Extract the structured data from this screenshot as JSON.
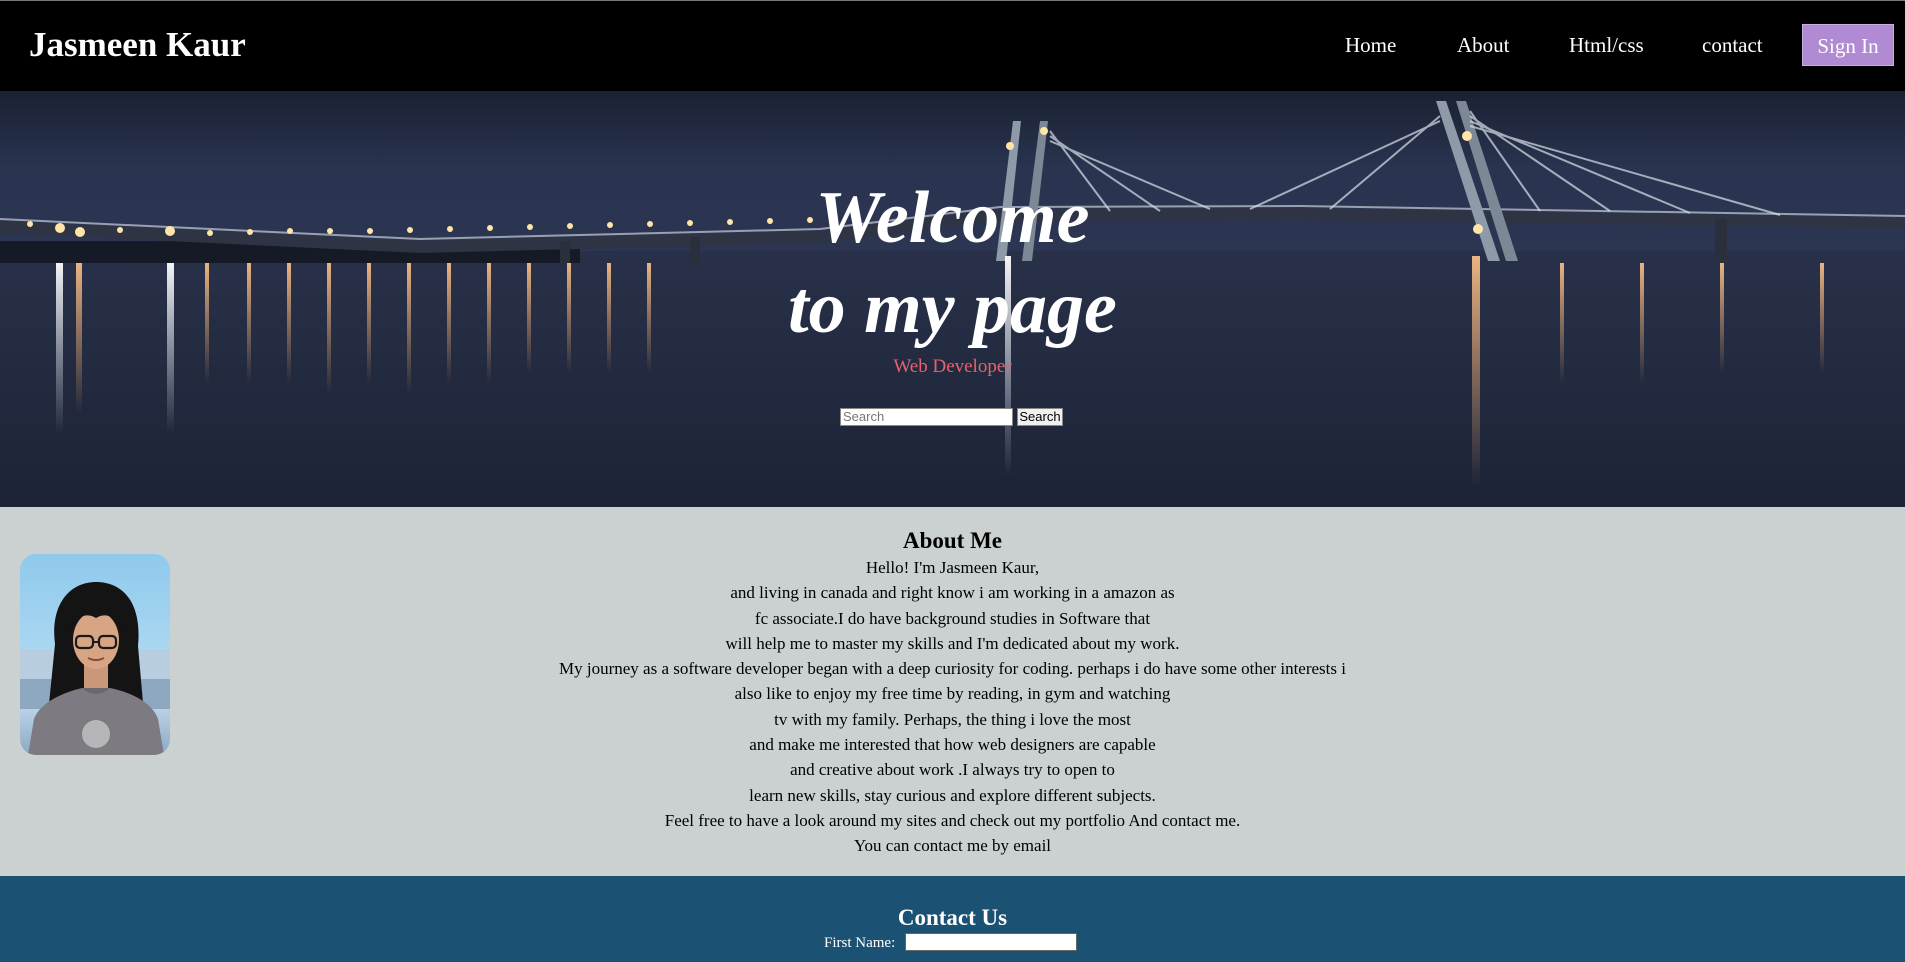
{
  "header": {
    "brand": "Jasmeen Kaur",
    "nav": [
      "Home",
      "About",
      "Html/css",
      "contact"
    ],
    "signin_label": "Sign In"
  },
  "hero": {
    "title_line1": "Welcome",
    "title_line2": "to my page",
    "subtitle": "Web Developer",
    "search_placeholder": "Search",
    "search_button": "Search"
  },
  "about": {
    "heading": "About Me",
    "lines": [
      "Hello! I'm Jasmeen Kaur,",
      "and living in canada and right know i am working in a amazon as",
      "fc associate.I do have background studies in Software that",
      "will help me to master my skills and I'm dedicated about my work.",
      "My journey as a software developer began with a deep curiosity for coding. perhaps i do have some other interests i",
      "also like to enjoy my free time by reading, in gym and watching",
      "tv with my family. Perhaps, the thing i love the most",
      "and make me interested that how web designers are capable",
      "and creative about work .I always try to open to",
      "learn new skills, stay curious and explore different subjects.",
      "Feel free to have a look around my sites and check out my portfolio And contact me.",
      "You can contact me by email"
    ]
  },
  "contact": {
    "heading": "Contact Us",
    "first_name_label": "First Name:"
  },
  "colors": {
    "navbar_bg": "#000000",
    "signin_bg": "#b08bd3",
    "subtitle": "#e8626e",
    "about_bg": "#cbd1d1",
    "contact_bg": "#1b5273"
  }
}
